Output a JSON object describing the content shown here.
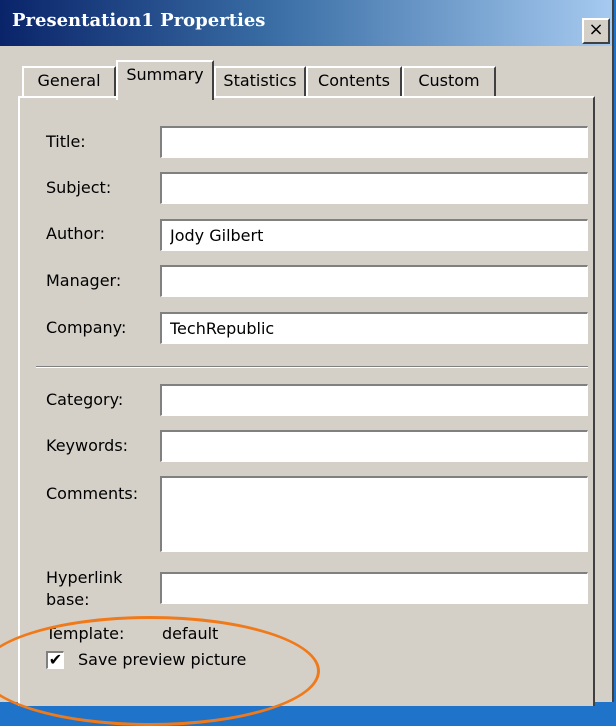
{
  "window": {
    "title": "Presentation1 Properties",
    "close_glyph": "×"
  },
  "tabs": [
    {
      "label": "General"
    },
    {
      "label": "Summary"
    },
    {
      "label": "Statistics"
    },
    {
      "label": "Contents"
    },
    {
      "label": "Custom"
    }
  ],
  "active_tab": "Summary",
  "fields": {
    "title": {
      "label": "Title:",
      "value": ""
    },
    "subject": {
      "label": "Subject:",
      "value": ""
    },
    "author": {
      "label": "Author:",
      "value": "Jody Gilbert"
    },
    "manager": {
      "label": "Manager:",
      "value": ""
    },
    "company": {
      "label": "Company:",
      "value": "TechRepublic"
    },
    "category": {
      "label": "Category:",
      "value": ""
    },
    "keywords": {
      "label": "Keywords:",
      "value": ""
    },
    "comments": {
      "label": "Comments:",
      "value": ""
    },
    "hyperlink_base": {
      "label_line1": "Hyperlink",
      "label_line2": "base:",
      "value": ""
    }
  },
  "template": {
    "label": "Template:",
    "value": "default"
  },
  "save_preview": {
    "label": "Save preview picture",
    "checked": true,
    "check_glyph": "✔"
  },
  "colors": {
    "title_bar_start": "#0a246a",
    "title_bar_end": "#a6caf0",
    "dialog_face": "#d4d0c8",
    "highlight_circle": "#f07a1a",
    "background": "#1f74c9"
  }
}
